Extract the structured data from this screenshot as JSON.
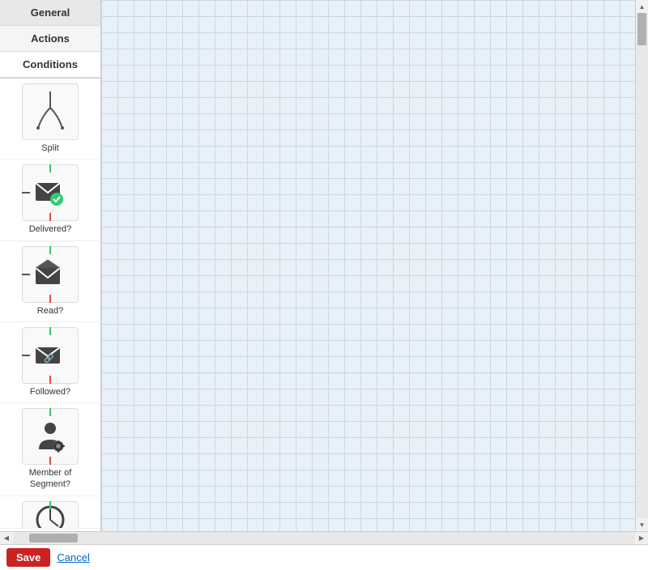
{
  "tabs": [
    {
      "id": "general",
      "label": "General",
      "active": false
    },
    {
      "id": "actions",
      "label": "Actions",
      "active": false
    },
    {
      "id": "conditions",
      "label": "Conditions",
      "active": true
    }
  ],
  "items": [
    {
      "id": "split",
      "label": "Split",
      "type": "split"
    },
    {
      "id": "delivered",
      "label": "Delivered?",
      "type": "delivered"
    },
    {
      "id": "read",
      "label": "Read?",
      "type": "read"
    },
    {
      "id": "followed",
      "label": "Followed?",
      "type": "followed"
    },
    {
      "id": "member-of-segment",
      "label": "Member of\nSegment?",
      "type": "member_of_segment"
    },
    {
      "id": "partial",
      "label": "",
      "type": "partial"
    }
  ],
  "canvas": {
    "grid_size": 20
  },
  "bottom_bar": {
    "save_label": "Save",
    "cancel_label": "Cancel"
  }
}
